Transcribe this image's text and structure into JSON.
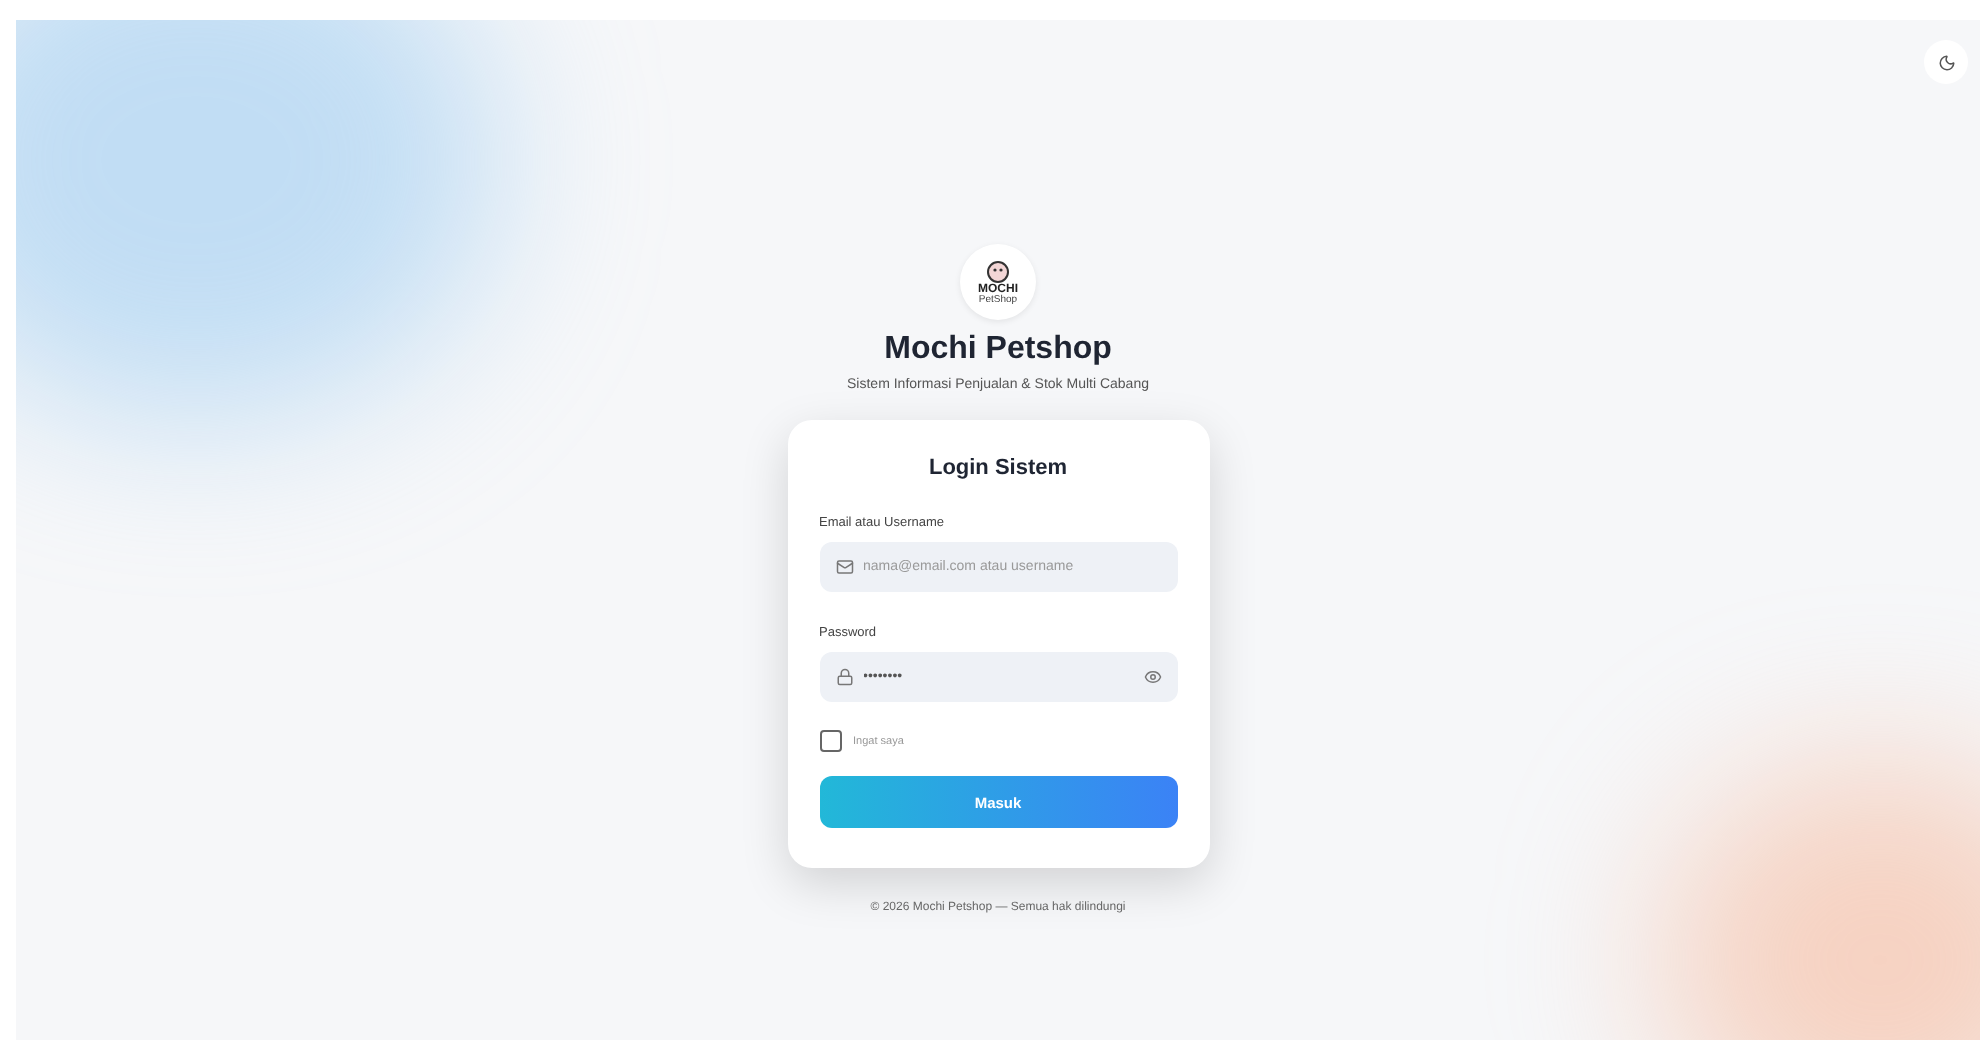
{
  "theme_toggle": {
    "dark": false
  },
  "brand": {
    "logo_text": "MOCHI",
    "logo_subtext": "PetShop",
    "title": "Mochi Petshop",
    "subtitle": "Sistem Informasi Penjualan & Stok Multi Cabang"
  },
  "login": {
    "title": "Login Sistem",
    "fields": [
      {
        "kind": "email",
        "label": "Email atau Username",
        "placeholder": "nama@email.com atau username"
      },
      {
        "kind": "password",
        "label": "Password",
        "value": "••••••••"
      }
    ],
    "remember": {
      "label": "Ingat saya",
      "checked": false
    },
    "submit": "Masuk"
  },
  "footer": "© 2026 Mochi Petshop — Semua hak dilindungi"
}
